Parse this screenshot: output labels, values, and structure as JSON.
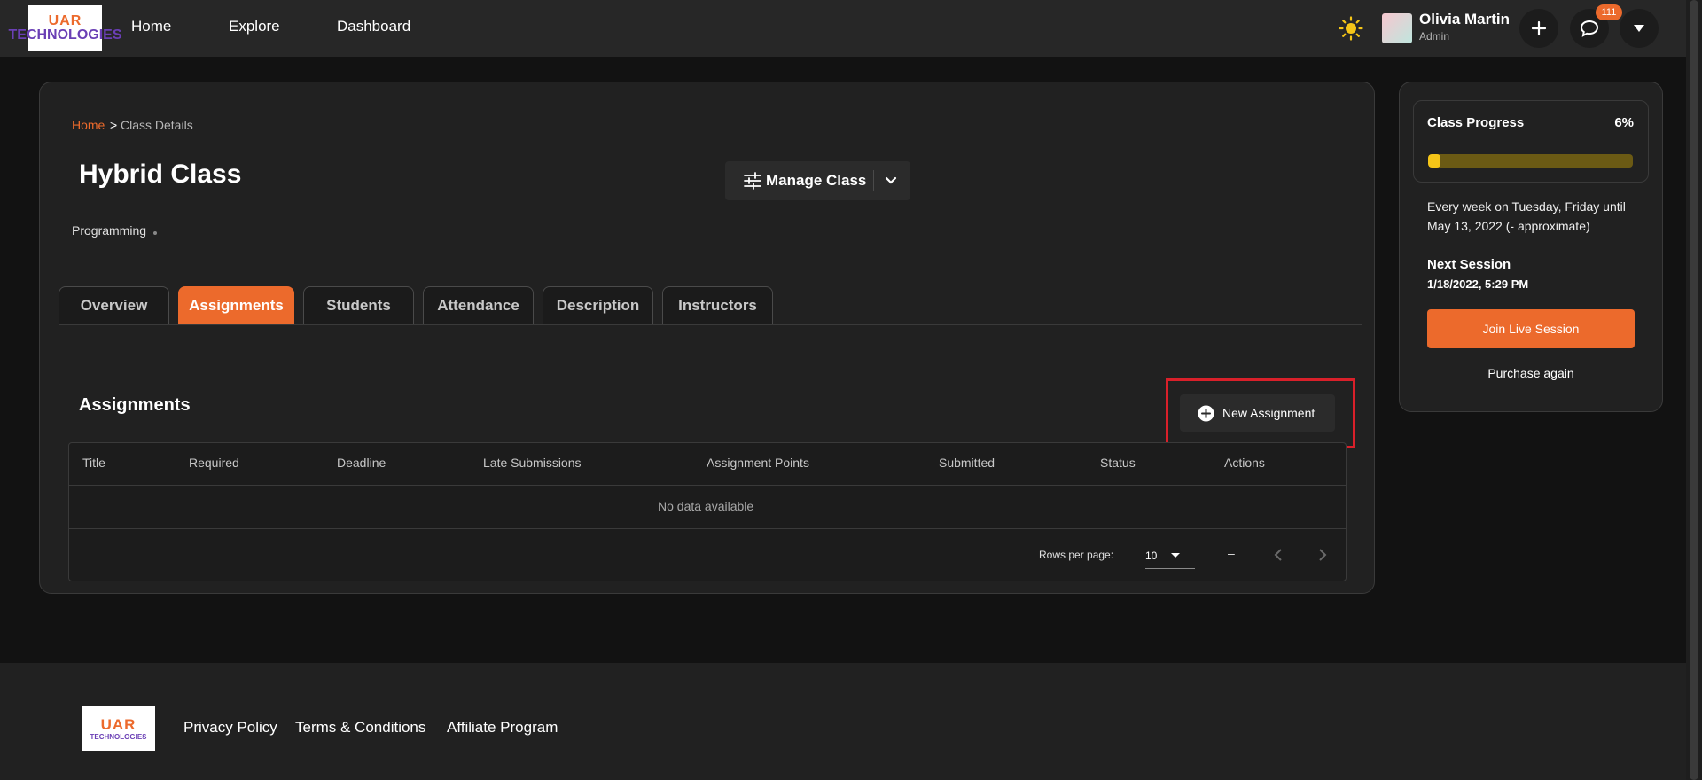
{
  "brand": {
    "logo_line1": "UAR",
    "logo_line2": "TECHNOLOGIES",
    "accent": "#ec6a2c"
  },
  "nav": {
    "links": [
      "Home",
      "Explore",
      "Dashboard"
    ]
  },
  "user": {
    "name": "Olivia Martin",
    "role": "Admin",
    "notification_count": "111"
  },
  "icons": [
    "sun-icon",
    "plus-icon",
    "chat-icon",
    "chevron-down-icon",
    "sliders-icon",
    "plus-circle-icon",
    "chevron-left-icon",
    "chevron-right-icon"
  ],
  "breadcrumb": {
    "home": "Home",
    "separator": ">",
    "current": "Class Details"
  },
  "class": {
    "title": "Hybrid Class",
    "category": "Programming",
    "manage_label": "Manage Class"
  },
  "tabs": [
    {
      "label": "Overview",
      "active": false
    },
    {
      "label": "Assignments",
      "active": true
    },
    {
      "label": "Students",
      "active": false
    },
    {
      "label": "Attendance",
      "active": false
    },
    {
      "label": "Description",
      "active": false
    },
    {
      "label": "Instructors",
      "active": false
    }
  ],
  "assignments": {
    "title": "Assignments",
    "new_button": "New Assignment",
    "columns": [
      "Title",
      "Required",
      "Deadline",
      "Late Submissions",
      "Assignment Points",
      "Submitted",
      "Status",
      "Actions"
    ],
    "empty_text": "No data available",
    "rows_per_page_label": "Rows per page:",
    "rows_per_page_value": "10",
    "range_text": "–"
  },
  "side": {
    "progress_title": "Class Progress",
    "progress_text": "6%",
    "progress_fraction": 0.06,
    "schedule": "Every week on Tuesday, Friday until May 13, 2022 (- approximate)",
    "next_label": "Next Session",
    "next_value": "1/18/2022, 5:29 PM",
    "join_label": "Join Live Session",
    "purchase_label": "Purchase again"
  },
  "footer": {
    "links": [
      "Privacy Policy",
      "Terms & Conditions",
      "Affiliate Program"
    ]
  }
}
